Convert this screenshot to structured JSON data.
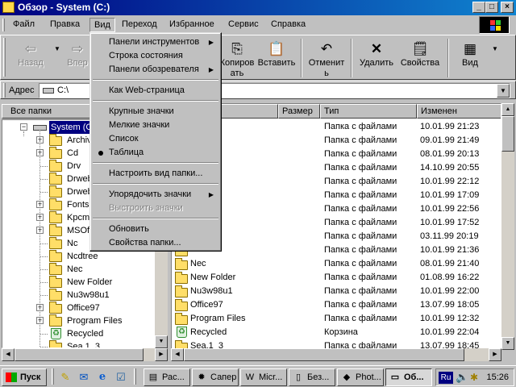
{
  "window": {
    "title": "Обзор - System (C:)",
    "buttons": {
      "minimize": "_",
      "maximize": "□",
      "close": "×"
    }
  },
  "menubar": {
    "items": [
      {
        "label": "Файл"
      },
      {
        "label": "Правка"
      },
      {
        "label": "Вид",
        "active": true
      },
      {
        "label": "Переход"
      },
      {
        "label": "Избранное"
      },
      {
        "label": "Сервис"
      },
      {
        "label": "Справка"
      }
    ]
  },
  "toolbar": {
    "back": "Назад",
    "forward": "Впер",
    "copy": "Копиров ать",
    "paste": "Вставить",
    "undo": "Отменит ь",
    "delete": "Удалить",
    "properties": "Свойства",
    "views": "Вид"
  },
  "address": {
    "label": "Адрес",
    "value": "C:\\"
  },
  "folders": {
    "title": "Все папки",
    "close": "×",
    "root": "System (C:)",
    "items": [
      {
        "label": "Archiv",
        "expandable": true
      },
      {
        "label": "Cd",
        "expandable": true
      },
      {
        "label": "Drv",
        "expandable": false
      },
      {
        "label": "Drweb",
        "expandable": false
      },
      {
        "label": "Drweb",
        "expandable": false
      },
      {
        "label": "Fonts.",
        "expandable": true
      },
      {
        "label": "Kpcms",
        "expandable": true
      },
      {
        "label": "MSOff",
        "expandable": true
      },
      {
        "label": "Nc",
        "expandable": false
      },
      {
        "label": "Ncdtree",
        "expandable": false
      },
      {
        "label": "Nec",
        "expandable": false
      },
      {
        "label": "New Folder",
        "expandable": false
      },
      {
        "label": "Nu3w98u1",
        "expandable": false
      },
      {
        "label": "Office97",
        "expandable": true
      },
      {
        "label": "Program Files",
        "expandable": true
      },
      {
        "label": "Recycled",
        "expandable": false,
        "icon": "recycle-bin-icon"
      },
      {
        "label": "Sea.1_3",
        "expandable": false
      }
    ]
  },
  "filelist": {
    "columns": {
      "name": "",
      "size": "Размер",
      "type": "Тип",
      "modified": "Изменен"
    },
    "rows": [
      {
        "name": "",
        "type": "Папка с файлами",
        "modified": "10.01.99 21:23"
      },
      {
        "name": "",
        "type": "Папка с файлами",
        "modified": "09.01.99 21:49"
      },
      {
        "name": "",
        "type": "Папка с файлами",
        "modified": "08.01.99 20:13"
      },
      {
        "name": "",
        "type": "Папка с файлами",
        "modified": "14.10.99 20:55"
      },
      {
        "name": "03",
        "type": "Папка с файлами",
        "modified": "10.01.99 22:12"
      },
      {
        "name": "",
        "type": "Папка с файлами",
        "modified": "10.01.99 17:09"
      },
      {
        "name": "",
        "type": "Папка с файлами",
        "modified": "10.01.99 22:56"
      },
      {
        "name": "e",
        "type": "Папка с файлами",
        "modified": "10.01.99 17:52"
      },
      {
        "name": "",
        "type": "Папка с файлами",
        "modified": "03.11.99 20:19"
      },
      {
        "name": "",
        "type": "Папка с файлами",
        "modified": "10.01.99 21:36"
      },
      {
        "name": "Nec",
        "type": "Папка с файлами",
        "modified": "08.01.99 21:40"
      },
      {
        "name": "New Folder",
        "type": "Папка с файлами",
        "modified": "01.08.99 16:22"
      },
      {
        "name": "Nu3w98u1",
        "type": "Папка с файлами",
        "modified": "10.01.99 22:00"
      },
      {
        "name": "Office97",
        "type": "Папка с файлами",
        "modified": "13.07.99 18:05"
      },
      {
        "name": "Program Files",
        "type": "Папка с файлами",
        "modified": "10.01.99 12:32"
      },
      {
        "name": "Recycled",
        "type": "Корзина",
        "modified": "10.01.99 22:04",
        "icon": "recycle-bin-icon"
      },
      {
        "name": "Sea.1_3",
        "type": "Папка с файлами",
        "modified": "13.07.99 18:45"
      }
    ]
  },
  "view_menu": {
    "items": [
      {
        "label": "Панели инструментов",
        "submenu": true
      },
      {
        "label": "Строка состояния"
      },
      {
        "label": "Панели обозревателя",
        "submenu": true
      },
      {
        "separator": true
      },
      {
        "label": "Как Web-страница"
      },
      {
        "separator": true
      },
      {
        "label": "Крупные значки"
      },
      {
        "label": "Мелкие значки"
      },
      {
        "label": "Список"
      },
      {
        "label": "Таблица",
        "checked": true
      },
      {
        "separator": true
      },
      {
        "label": "Настроить вид папки..."
      },
      {
        "separator": true
      },
      {
        "label": "Упорядочить значки",
        "submenu": true
      },
      {
        "label": "Выстроить значки",
        "disabled": true
      },
      {
        "separator": true
      },
      {
        "label": "Обновить"
      },
      {
        "label": "Свойства папки..."
      }
    ]
  },
  "taskbar": {
    "start": "Пуск",
    "quicklaunch": [
      "desktop-icon",
      "outlook-icon",
      "ie-icon",
      "channels-icon"
    ],
    "tasks": [
      {
        "label": "Рас...",
        "icon": "calc-icon"
      },
      {
        "label": "Сапер",
        "icon": "minesweeper-icon"
      },
      {
        "label": "Micr...",
        "icon": "word-icon"
      },
      {
        "label": "Без...",
        "icon": "notepad-icon"
      },
      {
        "label": "Phot...",
        "icon": "photoshop-icon"
      },
      {
        "label": "Об...",
        "icon": "explorer-icon",
        "active": true
      }
    ],
    "lang": "Ru",
    "clock": "15:26"
  }
}
